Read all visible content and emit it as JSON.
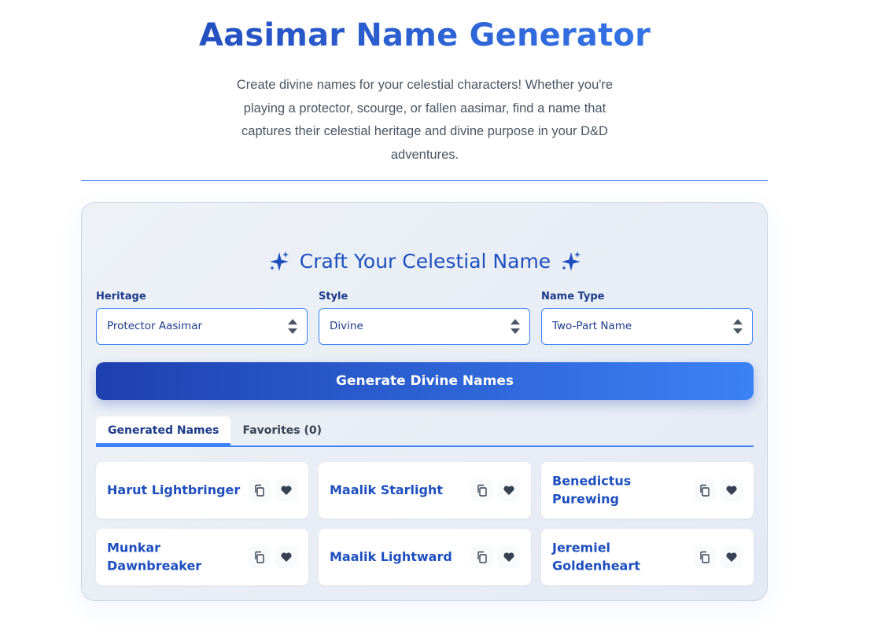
{
  "header": {
    "title": "Aasimar Name Generator",
    "intro": "Create divine names for your celestial characters! Whether you're playing a protector, scourge, or fallen aasimar, find a name that captures their celestial heritage and divine purpose in your D&D adventures."
  },
  "generator": {
    "title": "Craft Your Celestial Name",
    "fields": [
      {
        "label": "Heritage",
        "value": "Protector Aasimar"
      },
      {
        "label": "Style",
        "value": "Divine"
      },
      {
        "label": "Name Type",
        "value": "Two-Part Name"
      }
    ],
    "generate_label": "Generate Divine Names"
  },
  "tabs": [
    {
      "label": "Generated Names",
      "active": true
    },
    {
      "label": "Favorites (0)",
      "active": false
    }
  ],
  "names": [
    "Harut Lightbringer",
    "Maalik Starlight",
    "Benedictus Purewing",
    "Munkar Dawnbreaker",
    "Maalik Lightward",
    "Jeremiel Goldenheart"
  ],
  "icons": {
    "title_decoration": "sparkles-icon",
    "select_arrows": "sort-arrows-icon",
    "copy": "copy-icon",
    "favorite": "heart-icon"
  },
  "colors": {
    "primary": "#1e40af",
    "accent": "#3b82f6",
    "text_dark": "#1e3a8a",
    "body_text": "#4b5563"
  }
}
